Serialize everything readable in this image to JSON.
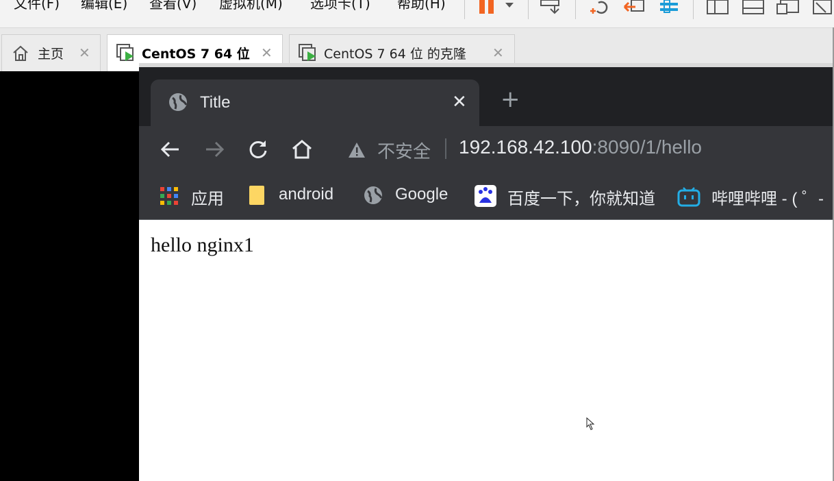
{
  "vmware": {
    "menu": [
      "文件(F)",
      "编辑(E)",
      "查看(V)",
      "虚拟机(M)",
      "选项卡(T)",
      "帮助(H)"
    ],
    "tabs": [
      {
        "label": "主页",
        "active": false
      },
      {
        "label": "CentOS 7 64 位",
        "active": true
      },
      {
        "label": "CentOS 7 64 位 的克隆",
        "active": false
      }
    ],
    "tab_close_glyph": "✕"
  },
  "chrome": {
    "tab": {
      "title": "Title",
      "close_glyph": "✕"
    },
    "new_tab_glyph": "+",
    "address": {
      "security_label": "不安全",
      "url_host": "192.168.42.100",
      "url_rest": ":8090/1/hello"
    },
    "bookmarks": [
      {
        "label": "应用",
        "icon": "apps-grid-icon"
      },
      {
        "label": "android",
        "icon": "folder-icon"
      },
      {
        "label": "Google",
        "icon": "globe-icon"
      },
      {
        "label": "百度一下，你就知道",
        "icon": "baidu-icon"
      },
      {
        "label": "哔哩哔哩 - ( ゜-",
        "icon": "bilibili-icon"
      }
    ],
    "page": {
      "text": "hello nginx1"
    }
  },
  "colors": {
    "chrome_dark": "#202124",
    "chrome_toolbar": "#35363a",
    "vm_accent_orange": "#f26522",
    "vm_accent_blue": "#1a9cd8",
    "vm_play_green": "#3cb043"
  }
}
